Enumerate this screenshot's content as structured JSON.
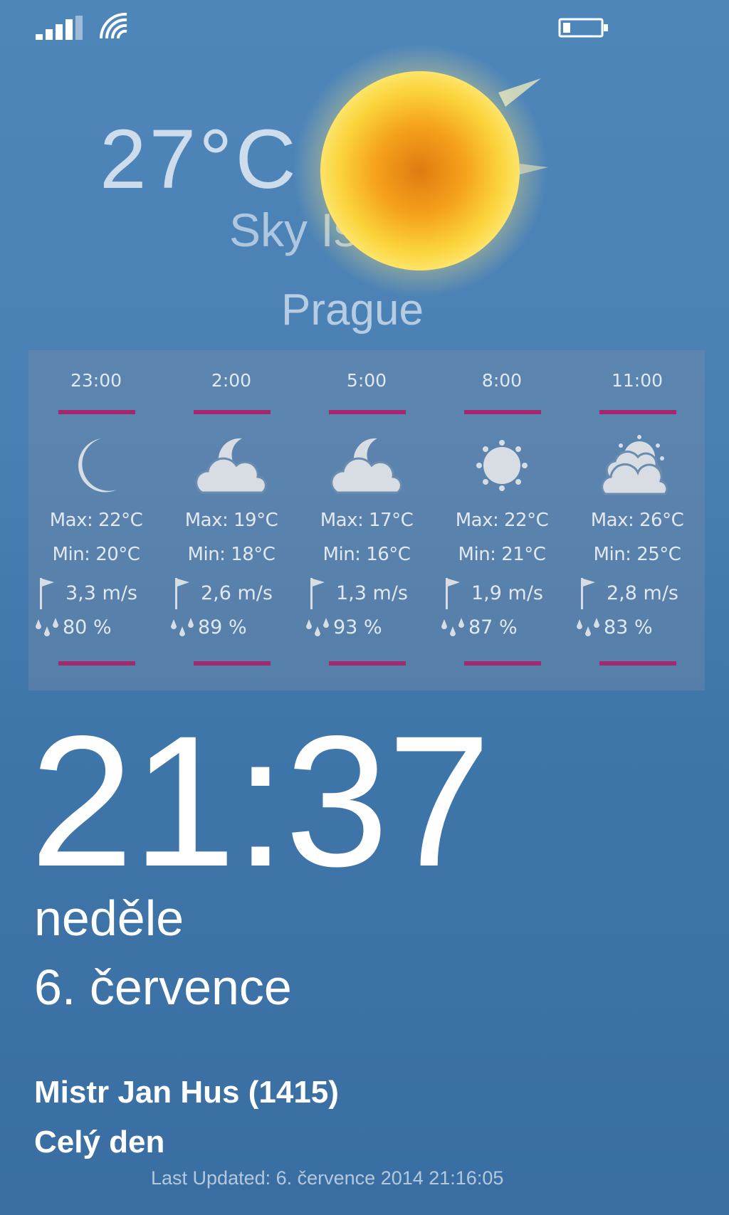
{
  "status_bar": {
    "icons": [
      "signal-icon",
      "wifi-icon",
      "battery-icon"
    ]
  },
  "weather": {
    "temperature": "27°C",
    "condition": "Sky Is Clear",
    "city": "Prague",
    "icon": "sun-icon"
  },
  "forecast": [
    {
      "time": "23:00",
      "icon": "moon-icon",
      "max": "Max: 22°C",
      "min": "Min: 20°C",
      "wind": "3,3 m/s",
      "humidity": "80 %"
    },
    {
      "time": "2:00",
      "icon": "moon-cloud-icon",
      "max": "Max: 19°C",
      "min": "Min: 18°C",
      "wind": "2,6 m/s",
      "humidity": "89 %"
    },
    {
      "time": "5:00",
      "icon": "moon-cloud-icon",
      "max": "Max: 17°C",
      "min": "Min: 16°C",
      "wind": "1,3 m/s",
      "humidity": "93 %"
    },
    {
      "time": "8:00",
      "icon": "sun-icon",
      "max": "Max: 22°C",
      "min": "Min: 21°C",
      "wind": "1,9 m/s",
      "humidity": "87 %"
    },
    {
      "time": "11:00",
      "icon": "sun-clouds-icon",
      "max": "Max: 26°C",
      "min": "Min: 25°C",
      "wind": "2,8 m/s",
      "humidity": "83 %"
    }
  ],
  "lockscreen": {
    "time": "21:37",
    "day": "neděle",
    "date": "6. července"
  },
  "event": {
    "title": "Mistr Jan Hus (1415)",
    "when": "Celý den"
  },
  "last_updated": "Last Updated: 6. července 2014 21:16:05",
  "colors": {
    "background": "#4a80b4",
    "accent_line": "#a4286e",
    "panel": "rgba(120,140,165,0.38)"
  }
}
